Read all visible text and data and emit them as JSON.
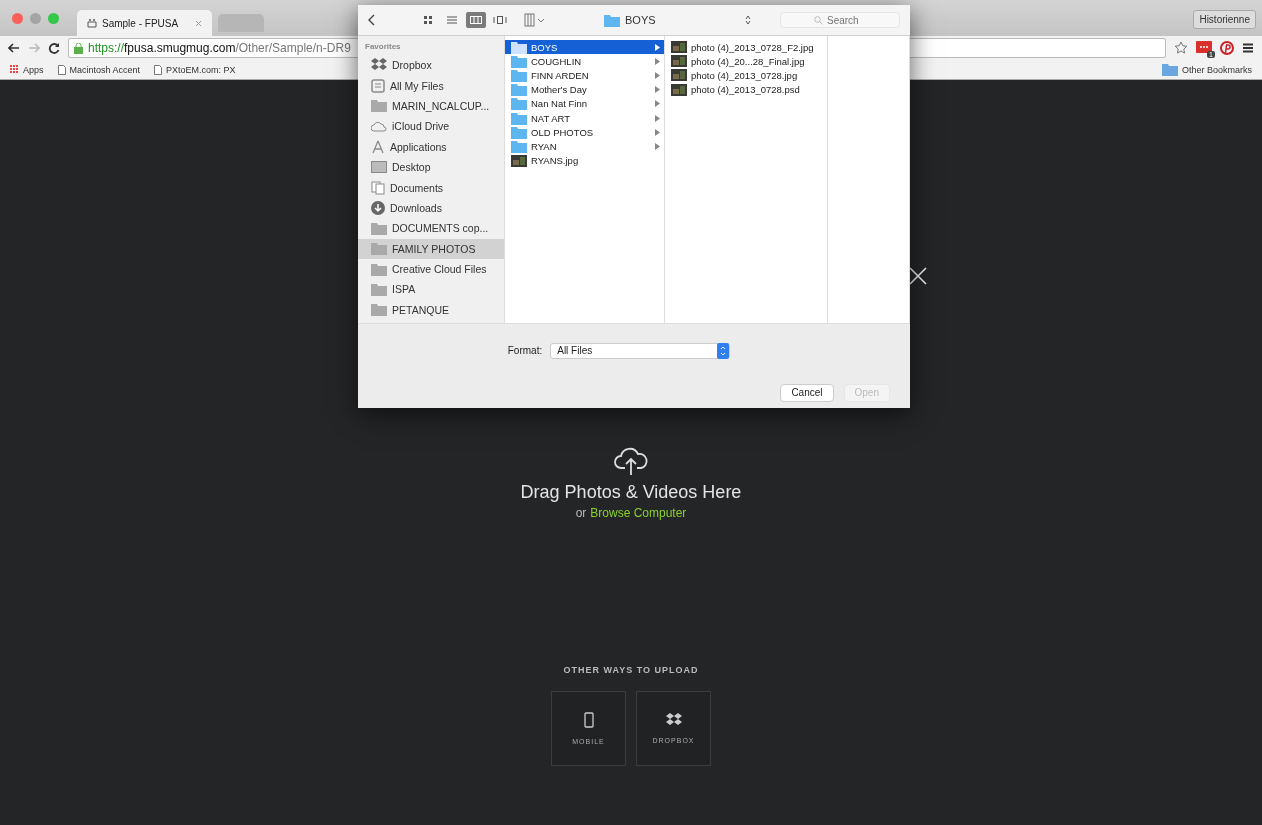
{
  "browser": {
    "tabs": [
      {
        "title": "Sample - FPUSA",
        "selected": true
      },
      {
        "selected": false
      }
    ],
    "profile": "Historienne",
    "url": {
      "scheme": "https://",
      "host": "fpusa.smugmug.com",
      "path": "/Other/Sample/n-DR9"
    },
    "extension_badge": "1",
    "bookmarks": [
      {
        "kind": "apps",
        "label": "Apps"
      },
      {
        "kind": "page",
        "label": "Macintosh Accent"
      },
      {
        "kind": "page",
        "label": "PXtoEM.com: PX"
      }
    ],
    "other_bookmarks": "Other Bookmarks"
  },
  "dialog": {
    "view_modes": [
      {
        "kind": "icons",
        "selected": false
      },
      {
        "kind": "list",
        "selected": false
      },
      {
        "kind": "columns",
        "selected": true
      },
      {
        "kind": "flow",
        "selected": false
      }
    ],
    "path": "BOYS",
    "search": {
      "placeholder": "Search"
    },
    "sidebar": {
      "heading": "Favorites",
      "items": [
        {
          "kind": "dropbox",
          "label": "Dropbox",
          "selected": false
        },
        {
          "kind": "files",
          "label": "All My Files",
          "selected": false
        },
        {
          "kind": "folder",
          "label": "MARIN_NCALCUP...",
          "selected": false
        },
        {
          "kind": "cloud",
          "label": "iCloud Drive",
          "selected": false
        },
        {
          "kind": "apps",
          "label": "Applications",
          "selected": false
        },
        {
          "kind": "desktop",
          "label": "Desktop",
          "selected": false
        },
        {
          "kind": "documents",
          "label": "Documents",
          "selected": false
        },
        {
          "kind": "downloads",
          "label": "Downloads",
          "selected": false
        },
        {
          "kind": "folder",
          "label": "DOCUMENTS cop...",
          "selected": false
        },
        {
          "kind": "folder",
          "label": "FAMILY PHOTOS",
          "selected": true
        },
        {
          "kind": "folder",
          "label": "Creative Cloud Files",
          "selected": false
        },
        {
          "kind": "folder",
          "label": "ISPA",
          "selected": false
        },
        {
          "kind": "folder",
          "label": "PETANQUE",
          "selected": false
        }
      ]
    },
    "columns": [
      [
        {
          "kind": "folder",
          "name": "BOYS",
          "selected": true
        },
        {
          "kind": "folder",
          "name": "COUGHLIN",
          "selected": false
        },
        {
          "kind": "folder",
          "name": "FINN ARDEN",
          "selected": false
        },
        {
          "kind": "folder",
          "name": "Mother's Day",
          "selected": false
        },
        {
          "kind": "folder",
          "name": "Nan Nat Finn",
          "selected": false
        },
        {
          "kind": "folder",
          "name": "NAT ART",
          "selected": false
        },
        {
          "kind": "folder",
          "name": "OLD PHOTOS",
          "selected": false
        },
        {
          "kind": "folder",
          "name": "RYAN",
          "selected": false
        },
        {
          "kind": "image",
          "name": "RYANS.jpg",
          "selected": false
        }
      ],
      [
        {
          "kind": "image",
          "name": "photo (4)_2013_0728_F2.jpg",
          "selected": false
        },
        {
          "kind": "image",
          "name": "photo (4)_20...28_Final.jpg",
          "selected": false
        },
        {
          "kind": "image",
          "name": "photo (4)_2013_0728.jpg",
          "selected": false
        },
        {
          "kind": "image",
          "name": "photo (4)_2013_0728.psd",
          "selected": false
        }
      ]
    ],
    "format": {
      "label": "Format:",
      "value": "All Files"
    },
    "buttons": [
      {
        "label": "Cancel",
        "disabled": false
      },
      {
        "label": "Open",
        "disabled": true
      }
    ]
  },
  "upload": {
    "heading": "Drag Photos & Videos Here",
    "or": "or",
    "browse_link": "Browse Computer",
    "other_heading": "OTHER WAYS TO UPLOAD",
    "options": [
      {
        "kind": "mobile",
        "label": "MOBILE"
      },
      {
        "kind": "dropbox",
        "label": "DROPBOX"
      }
    ]
  }
}
